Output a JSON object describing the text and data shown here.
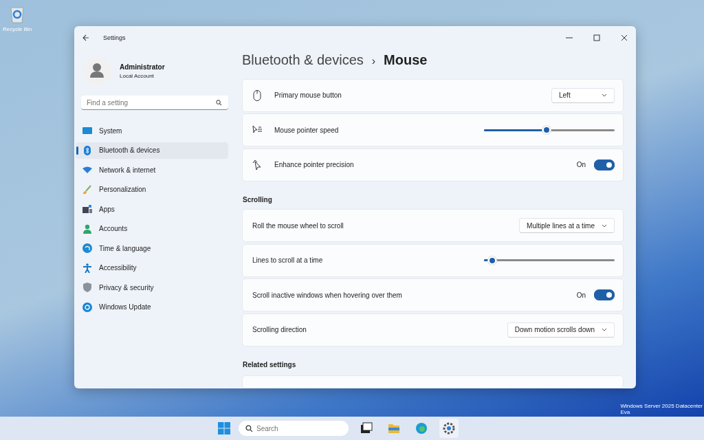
{
  "desktop": {
    "icon_label": "Recycle Bin",
    "watermark_lines": [
      "Windows Server 2025 Datacenter",
      "Eva"
    ]
  },
  "window": {
    "title": "Settings"
  },
  "account": {
    "name": "Administrator",
    "type": "Local Account"
  },
  "search": {
    "placeholder": "Find a setting"
  },
  "sidebar": {
    "items": [
      {
        "label": "System",
        "selected": false
      },
      {
        "label": "Bluetooth & devices",
        "selected": true
      },
      {
        "label": "Network & internet",
        "selected": false
      },
      {
        "label": "Personalization",
        "selected": false
      },
      {
        "label": "Apps",
        "selected": false
      },
      {
        "label": "Accounts",
        "selected": false
      },
      {
        "label": "Time & language",
        "selected": false
      },
      {
        "label": "Accessibility",
        "selected": false
      },
      {
        "label": "Privacy & security",
        "selected": false
      },
      {
        "label": "Windows Update",
        "selected": false
      }
    ]
  },
  "breadcrumb": {
    "parent": "Bluetooth & devices",
    "separator": "›",
    "current": "Mouse"
  },
  "groups": [
    {
      "rows": [
        {
          "kind": "dropdown",
          "label": "Primary mouse button",
          "value": "Left"
        },
        {
          "kind": "slider",
          "label": "Mouse pointer speed",
          "level": 0.47
        },
        {
          "kind": "toggle",
          "label": "Enhance pointer precision",
          "state_text": "On",
          "on": true
        }
      ]
    },
    {
      "title": "Scrolling",
      "rows": [
        {
          "kind": "dropdown",
          "label": "Roll the mouse wheel to scroll",
          "value": "Multiple lines at a time"
        },
        {
          "kind": "slider",
          "label": "Lines to scroll at a time",
          "level": 0.05
        },
        {
          "kind": "toggle",
          "label": "Scroll inactive windows when hovering over them",
          "state_text": "On",
          "on": true
        },
        {
          "kind": "dropdown",
          "label": "Scrolling direction",
          "value": "Down motion scrolls down"
        }
      ]
    },
    {
      "title": "Related settings"
    }
  ],
  "taskbar": {
    "search_placeholder": "Search",
    "apps": [
      {
        "selected": false
      },
      {
        "selected": false
      },
      {
        "selected": false
      },
      {
        "selected": true
      }
    ]
  }
}
